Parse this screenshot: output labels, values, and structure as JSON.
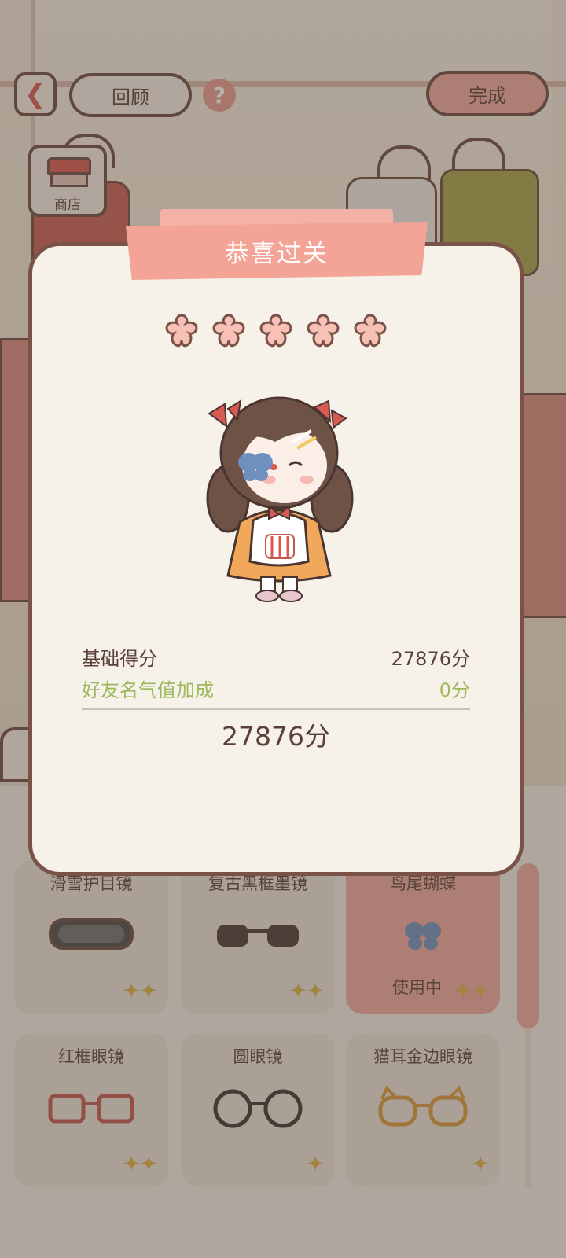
{
  "topbar": {
    "review_label": "回顾",
    "done_label": "完成",
    "help_symbol": "?",
    "back_symbol": "❮"
  },
  "shop": {
    "label": "商店"
  },
  "items": [
    {
      "name": "滑雪护目镜",
      "status": "",
      "icon": "ski-goggles-icon"
    },
    {
      "name": "复古黑框墨镜",
      "status": "",
      "icon": "black-sunglasses-icon"
    },
    {
      "name": "鸟尾蝴蝶",
      "status": "使用中",
      "icon": "blue-butterfly-icon"
    },
    {
      "name": "红框眼镜",
      "status": "",
      "icon": "red-glasses-icon"
    },
    {
      "name": "圆眼镜",
      "status": "",
      "icon": "round-glasses-icon"
    },
    {
      "name": "猫耳金边眼镜",
      "status": "",
      "icon": "cat-ear-glasses-icon"
    }
  ],
  "modal": {
    "title": "恭喜过关",
    "stars": 5,
    "rows": [
      {
        "label": "基础得分",
        "value": "27876分"
      },
      {
        "label": "好友名气值加成",
        "value": "0分"
      }
    ],
    "total": "27876分"
  },
  "colors": {
    "accent": "#f3a496",
    "outline": "#7a5248",
    "green": "#9cb85b",
    "text": "#5a4038"
  }
}
